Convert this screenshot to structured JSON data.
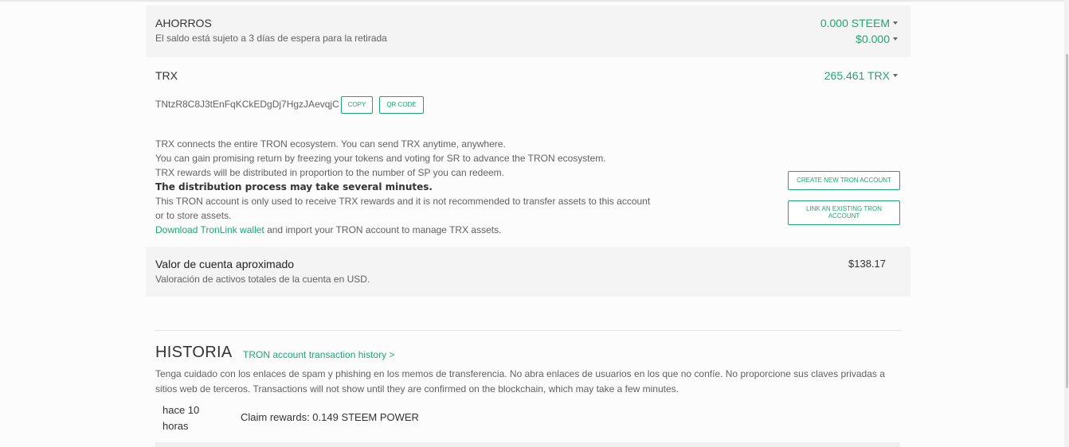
{
  "savings": {
    "title": "AHORROS",
    "subtitle": "El saldo está sujeto a 3 días de espera para la retirada",
    "steem_amount": "0.000 STEEM",
    "usd_amount": "$0.000"
  },
  "trx": {
    "title": "TRX",
    "amount": "265.461 TRX",
    "address": "TNtzR8C8J3tEnFqKCkEDgDj7HgzJAevqjC",
    "copy_label": "COPY",
    "qr_label": "QR CODE",
    "lines": [
      "TRX connects the entire TRON ecosystem. You can send TRX anytime, anywhere.",
      "You can gain promising return by freezing your tokens and voting for SR to advance the TRON ecosystem.",
      "TRX rewards will be distributed in proportion to the number of SP you can redeem."
    ],
    "bold_line": "The distribution process may take several minutes.",
    "note": "This TRON account is only used to receive TRX rewards and it is not recommended to transfer assets to this account or to store assets.",
    "download_link": "Download TronLink wallet",
    "download_rest": " and import your TRON account to manage TRX assets.",
    "create_button": "CREATE NEW TRON ACCOUNT",
    "link_button": "LINK AN EXISTING TRON ACCOUNT"
  },
  "account_value": {
    "title": "Valor de cuenta aproximado",
    "subtitle": "Valoración de activos totales de la cuenta en USD.",
    "amount": "$138.17"
  },
  "history": {
    "title": "HISTORIA",
    "tron_link": "TRON account transaction history >",
    "warning": "Tenga cuidado con los enlaces de spam y phishing en los memos de transferencia. No abra enlaces de usuarios en los que no confíe. No proporcione sus claves privadas a sitios web de terceros. Transactions will not show until they are confirmed on the blockchain, which may take a few minutes.",
    "transactions": [
      {
        "time": "hace 10 horas",
        "description": "Claim rewards: 0.149 STEEM POWER"
      }
    ]
  },
  "colors": {
    "accent": "#1aa873",
    "panel": "#f4f4f4"
  }
}
